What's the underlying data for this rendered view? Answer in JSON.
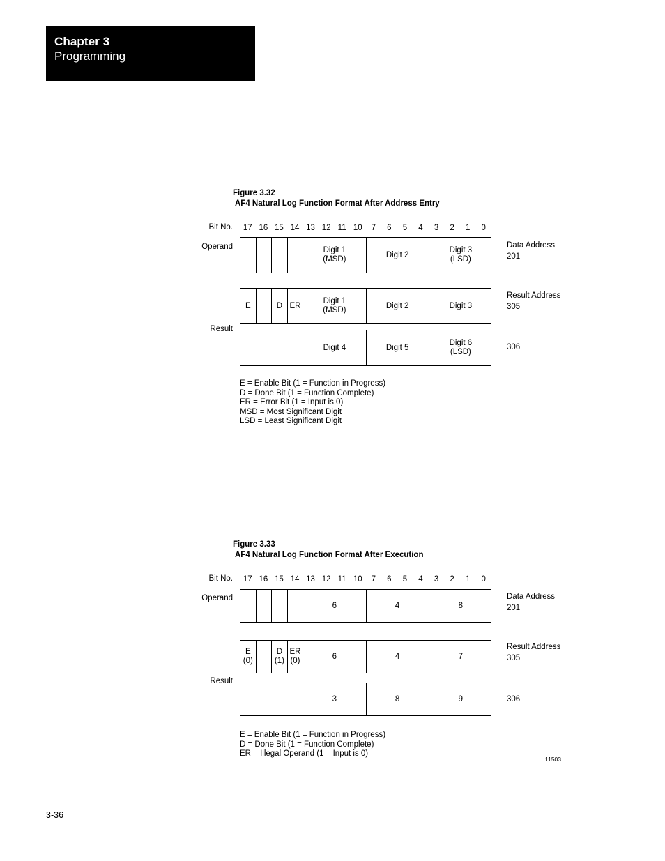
{
  "header": {
    "chapter_label": "Chapter 3",
    "chapter_title": "Programming"
  },
  "bit_numbers": [
    "17",
    "16",
    "15",
    "14",
    "13",
    "12",
    "11",
    "10",
    "7",
    "6",
    "5",
    "4",
    "3",
    "2",
    "1",
    "0"
  ],
  "labels": {
    "bit_no": "Bit No.",
    "operand": "Operand",
    "result": "Result"
  },
  "figures": [
    {
      "number": "Figure 3.32",
      "title": "AF4 Natural Log Function Format After Address Entry",
      "operand_row": {
        "narrow_cells": [
          "",
          "",
          "",
          ""
        ],
        "digit_cells": [
          {
            "main": "Digit 1",
            "sub": "(MSD)"
          },
          {
            "main": "Digit 2",
            "sub": ""
          },
          {
            "main": "Digit 3",
            "sub": "(LSD)"
          }
        ],
        "address_title": "Data Address",
        "address_value": "201"
      },
      "result_row_1": {
        "narrow_cells": [
          "E",
          "",
          "D",
          "ER"
        ],
        "digit_cells": [
          {
            "main": "Digit 1",
            "sub": "(MSD)"
          },
          {
            "main": "Digit  2",
            "sub": ""
          },
          {
            "main": "Digit 3",
            "sub": ""
          }
        ],
        "address_title": "Result Address",
        "address_value": "305"
      },
      "result_row_2": {
        "blank_span": "",
        "digit_cells": [
          {
            "main": "Digit 4",
            "sub": ""
          },
          {
            "main": "Digit 5",
            "sub": ""
          },
          {
            "main": "Digit 6",
            "sub": "(LSD)"
          }
        ],
        "address_title": "",
        "address_value": "306"
      },
      "legend": [
        "E = Enable Bit (1 = Function in Progress)",
        "D = Done Bit (1 = Function Complete)",
        "ER = Error Bit (1 = Input is 0)",
        "MSD = Most Significant Digit",
        "LSD = Least Significant Digit"
      ]
    },
    {
      "number": "Figure 3.33",
      "title": "AF4 Natural Log Function Format After Execution",
      "operand_row": {
        "narrow_cells": [
          "",
          "",
          "",
          ""
        ],
        "digit_cells": [
          {
            "main": "6",
            "sub": ""
          },
          {
            "main": "4",
            "sub": ""
          },
          {
            "main": "8",
            "sub": ""
          }
        ],
        "address_title": "Data Address",
        "address_value": "201"
      },
      "result_row_1": {
        "narrow_cells_main": [
          "E",
          "",
          "D",
          "ER"
        ],
        "narrow_cells_sub": [
          "(0)",
          "",
          "(1)",
          "(0)"
        ],
        "digit_cells": [
          {
            "main": "6",
            "sub": ""
          },
          {
            "main": "4",
            "sub": ""
          },
          {
            "main": "7",
            "sub": ""
          }
        ],
        "address_title": "Result Address",
        "address_value": "305"
      },
      "result_row_2": {
        "blank_span": "",
        "digit_cells": [
          {
            "main": "3",
            "sub": ""
          },
          {
            "main": "8",
            "sub": ""
          },
          {
            "main": "9",
            "sub": ""
          }
        ],
        "address_title": "",
        "address_value": "306"
      },
      "legend": [
        "E = Enable Bit (1 = Function in Progress)",
        "D = Done Bit (1 = Function Complete)",
        "ER = Illegal Operand (1 = Input is 0)"
      ]
    }
  ],
  "artwork_id": "11503",
  "page_number": "3-36"
}
